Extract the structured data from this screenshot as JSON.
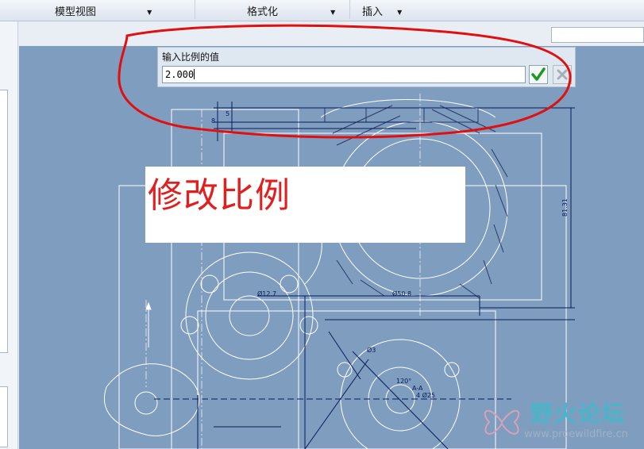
{
  "ribbon": {
    "groups": [
      {
        "label": "模型视图"
      },
      {
        "label": "格式化"
      },
      {
        "label": "插入"
      }
    ]
  },
  "scale_dialog": {
    "prompt": "输入比例的值",
    "value": "2.000"
  },
  "annotation": {
    "text": "修改比例",
    "color": "#e02020"
  },
  "drawing_dimensions": {
    "d1": "Ø12.7",
    "d2": "Ø50.8",
    "d3": "Ø3",
    "d4": "120°",
    "d5": "A-A",
    "d6": "4 Ø25",
    "d7": "8",
    "d8": "5",
    "d9": "81.31"
  },
  "watermark": {
    "title": "野火论坛",
    "url": "www.proewildfire.cn"
  },
  "colors": {
    "canvas": "#7f9dbf",
    "drawing_lines": "#ffffff",
    "dimension_lines": "#0a1a5a",
    "highlight_ellipse": "#e01010"
  }
}
